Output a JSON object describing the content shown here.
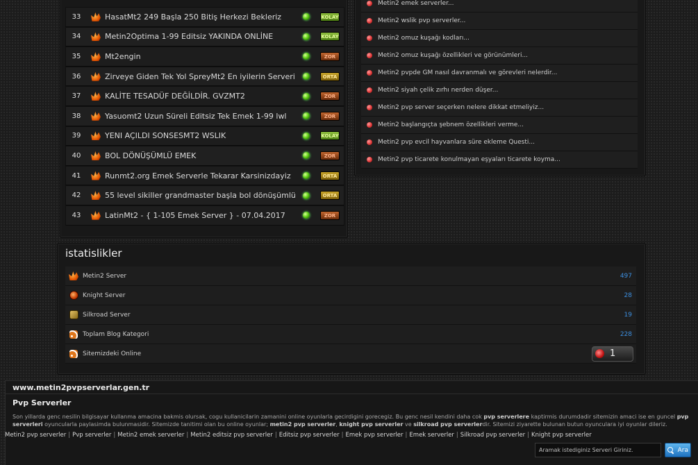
{
  "servers": [
    {
      "num": "33",
      "name": "HasatMt2 249 Başla 250 Bitiş Herkezi Bekleriz",
      "difficulty": "KOLAY",
      "level": "kolay"
    },
    {
      "num": "34",
      "name": "Metin2Optima 1-99 Editsiz YAKINDA ONLİNE",
      "difficulty": "KOLAY",
      "level": "kolay"
    },
    {
      "num": "35",
      "name": "Mt2engin",
      "difficulty": "ZOR",
      "level": "zor"
    },
    {
      "num": "36",
      "name": "Zirveye Giden Tek Yol SpreyMt2 En iyilerin Serveri",
      "difficulty": "ORTA",
      "level": "orta"
    },
    {
      "num": "37",
      "name": "KALİTE TESADÜF DEĞİLDİR. GVZMT2",
      "difficulty": "ZOR",
      "level": "zor"
    },
    {
      "num": "38",
      "name": "Yasuomt2 Uzun Süreli Editsiz Tek Emek 1-99 lwl",
      "difficulty": "ZOR",
      "level": "zor"
    },
    {
      "num": "39",
      "name": "YENI AÇILDI SONSESMT2 WSLIK",
      "difficulty": "KOLAY",
      "level": "kolay"
    },
    {
      "num": "40",
      "name": "BOL DÖNÜŞÜMLÜ EMEK",
      "difficulty": "ZOR",
      "level": "zor"
    },
    {
      "num": "41",
      "name": "Runmt2.org Emek Serverle Tekarar Karsinizdayiz",
      "difficulty": "ORTA",
      "level": "orta"
    },
    {
      "num": "42",
      "name": "55 level sikiller grandmaster başla bol dönüşümlü",
      "difficulty": "ORTA",
      "level": "orta"
    },
    {
      "num": "43",
      "name": "LatinMt2 - { 1-105 Emek Server } - 07.04.2017",
      "difficulty": "ZOR",
      "level": "zor"
    }
  ],
  "blog_posts": [
    "Metin2 emek serverler...",
    "Metin2 wslik pvp serverler...",
    "Metin2 omuz kuşağı kodları...",
    "Metin2 omuz kuşağı özellikleri ve görünümleri...",
    "Metin2 pvpde GM nasıl davranmalı ve görevleri nelerdir...",
    "Metin2 siyah çelik zırhı nerden düşer...",
    "Metin2 pvp server seçerken nelere dikkat etmeliyiz...",
    "Metin2 başlangıçta şebnem özellikleri verme...",
    "Metin2 pvp evcil hayvanlara süre ekleme Questi...",
    "Metin2 pvp ticarete konulmayan eşyaları ticarete koyma..."
  ],
  "stats": {
    "title": "istatislikler",
    "rows": [
      {
        "label": "Metin2 Server",
        "value": "497",
        "icon": "metin2-icon"
      },
      {
        "label": "Knight Server",
        "value": "28",
        "icon": "knight-icon"
      },
      {
        "label": "Silkroad Server",
        "value": "19",
        "icon": "silkroad-icon"
      },
      {
        "label": "Toplam Blog Kategori",
        "value": "228",
        "icon": "rss-icon"
      }
    ],
    "online_label": "Sitemizdeki Online",
    "online_count": "1"
  },
  "footer": {
    "site_url": "www.metin2pvpserverlar.gen.tr",
    "section_title": "Pvp Serverler",
    "desc_parts": [
      "Son yillarda genc nesilin bilgisayar kullanma amacina bakmis olursak, cogu kullanicilarin zamanini online oyunlarla gecirdigini gorecegiz. Bu genc nesil kendini daha cok ",
      "pvp serverlere",
      " kaptirmis durumdadir sitemizin amaci ise en guncel ",
      "pvp serverleri",
      " oyuncularla paylasimda bulunmasidir. Sitemizde tanitimi olan bu online oyunlar; ",
      "metin2 pvp serverler",
      ", ",
      "knight pvp serverler",
      " ve ",
      "silkroad pvp serverler",
      "dir. Sitemizi ziyarette bulunan butun oyunculara iyi oyunlar dileriz."
    ],
    "links": [
      "Metin2 pvp serverler",
      "Pvp serverler",
      "Metin2 emek serverler",
      "Metin2 editsiz pvp serverler",
      "Editsiz pvp serverler",
      "Emek pvp serverler",
      "Emek serverler",
      "Silkroad pvp serverler",
      "Knight pvp serverler"
    ],
    "link_separator": "|",
    "search_placeholder": "Aramak istediginiz Serveri Giriniz.",
    "search_button_label": "Ara"
  },
  "colors": {
    "link_value": "#3d8fe0",
    "accent_button": "#1e72bf"
  }
}
